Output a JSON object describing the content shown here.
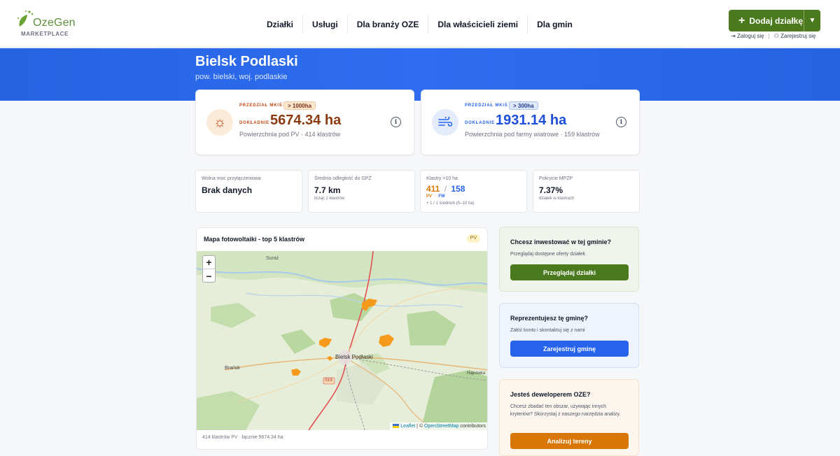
{
  "brand": {
    "name": "OzeGen",
    "subtitle": "MARKETPLACE"
  },
  "nav": [
    "Działki",
    "Usługi",
    "Dla branży OZE",
    "Dla właścicieli ziemi",
    "Dla gmin"
  ],
  "actions": {
    "add_label": "Dodaj działkę",
    "login": "Zaloguj się",
    "separator": "|",
    "register": "Zarejestruj się"
  },
  "hero": {
    "title": "Bielsk Podlaski",
    "subtitle": "pow. bielski, woj. podlaskie"
  },
  "stats": {
    "pv": {
      "range_label": "PRZEDZIAŁ MKIŚ",
      "range_badge": "> 1000ha",
      "exact_label": "DOKŁADNIE",
      "value": "5674.34 ha",
      "caption": "Powierzchnia pod PV · 414 klastrów",
      "icon": "sun-icon",
      "color": "#8a3b12"
    },
    "wind": {
      "range_label": "PRZEDZIAŁ MKIŚ",
      "range_badge": "> 300ha",
      "exact_label": "DOKŁADNIE",
      "value": "1931.14 ha",
      "caption": "Powierzchnia pod farmy wiatrowe · 159 klastrów",
      "icon": "wind-icon",
      "color": "#1d4ed8"
    }
  },
  "kpis": {
    "power": {
      "label": "Wolna moc przyłączeniowa",
      "value": "Brak danych"
    },
    "gpz": {
      "label": "Średnia odległość do GPZ",
      "value": "7.7 km",
      "sub": "licząc z klastrów"
    },
    "clusters": {
      "label": "Klastry >10 ha",
      "pv_value": "411",
      "sep": "/",
      "fw_value": "158",
      "pv_tag": "PV",
      "fw_tag": "FW",
      "sub": "+ 1 / 1 średnich (5–10 ha)"
    },
    "mpzp": {
      "label": "Pokrycie MPZP",
      "value": "7.37%",
      "sub": "działek w klastrach"
    }
  },
  "map": {
    "title": "Mapa fotowoltaiki - top 5 klastrów",
    "tag": "PV",
    "zoom_in": "+",
    "zoom_out": "−",
    "places": {
      "suraz": "Suraż",
      "bielsk": "Bielsk Podlaski",
      "bransk": "Brańsk",
      "hajnowka": "Hajnówka",
      "road": "S19"
    },
    "attribution": {
      "leaflet": "Leaflet",
      "sep": " | © ",
      "osm": "OpenStreetMap",
      "contrib": " contributors"
    },
    "footer": "414 klastrów PV · łącznie 5674.34 ha"
  },
  "cta": [
    {
      "title": "Chcesz inwestować w tej gminie?",
      "desc": "Przeglądaj dostępne oferty działek",
      "button": "Przeglądaj działki"
    },
    {
      "title": "Reprezentujesz tę gminę?",
      "desc": "Załóż konto i skontaktuj się z nami",
      "button": "Zarejestruj gminę"
    },
    {
      "title": "Jesteś deweloperem OZE?",
      "desc": "Chcesz zbadać ten obszar, używając innych kryteriów? Skorzystaj z naszego narzędzia analizy.",
      "button": "Analizuj tereny"
    }
  ]
}
